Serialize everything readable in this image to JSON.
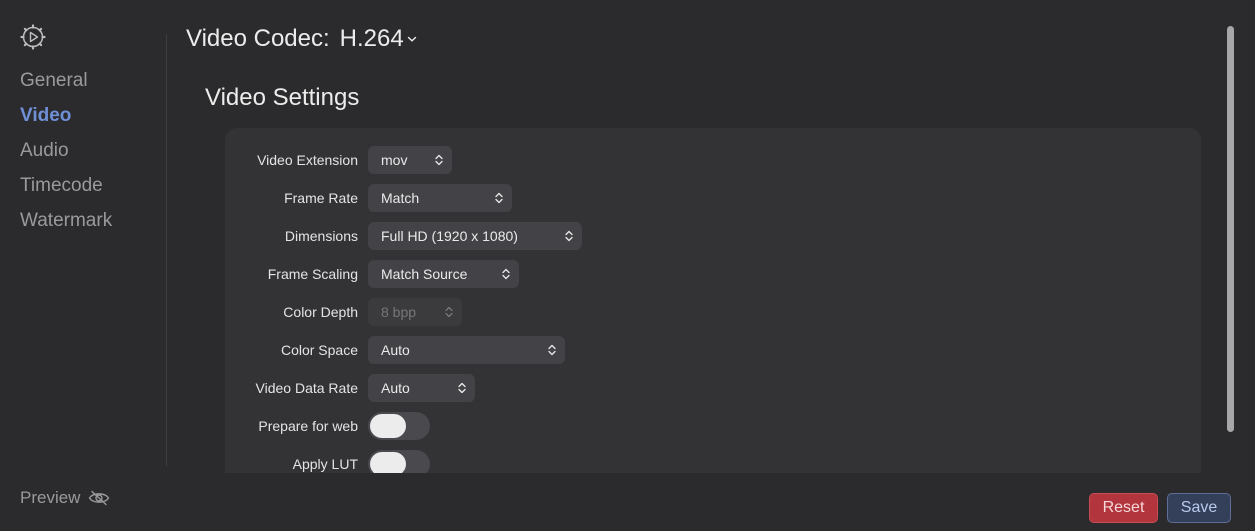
{
  "sidebar": {
    "items": [
      {
        "label": "General",
        "active": false
      },
      {
        "label": "Video",
        "active": true
      },
      {
        "label": "Audio",
        "active": false
      },
      {
        "label": "Timecode",
        "active": false
      },
      {
        "label": "Watermark",
        "active": false
      }
    ],
    "preview_label": "Preview",
    "active_color": "#6f8fd6"
  },
  "header": {
    "codec_label": "Video Codec:",
    "codec_value": "H.264"
  },
  "section": {
    "title": "Video Settings"
  },
  "settings": {
    "video_extension": {
      "label": "Video Extension",
      "value": "mov"
    },
    "frame_rate": {
      "label": "Frame Rate",
      "value": "Match"
    },
    "dimensions": {
      "label": "Dimensions",
      "value": "Full HD (1920 x 1080)"
    },
    "frame_scaling": {
      "label": "Frame Scaling",
      "value": "Match Source"
    },
    "color_depth": {
      "label": "Color Depth",
      "value": "8 bpp",
      "disabled": true
    },
    "color_space": {
      "label": "Color Space",
      "value": "Auto"
    },
    "video_data_rate": {
      "label": "Video Data Rate",
      "value": "Auto"
    },
    "prepare_for_web": {
      "label": "Prepare for web",
      "on": false
    },
    "apply_lut": {
      "label": "Apply LUT",
      "on": false
    }
  },
  "footer": {
    "reset_label": "Reset",
    "save_label": "Save",
    "reset_color": "#b2353d",
    "save_color": "#34405a"
  }
}
